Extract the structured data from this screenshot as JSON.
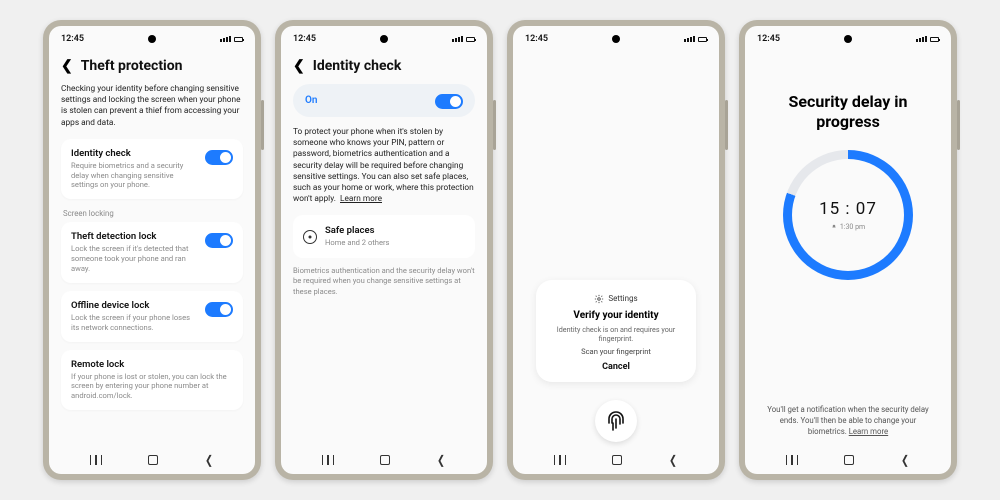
{
  "status": {
    "time": "12:45"
  },
  "screen1": {
    "title": "Theft protection",
    "desc": "Checking your identity before changing sensitive settings and locking the screen when your phone is stolen can prevent a thief from accessing your apps and data.",
    "identity": {
      "title": "Identity check",
      "sub": "Require biometrics and a security delay when changing sensitive settings on your phone."
    },
    "section_label": "Screen locking",
    "theft_lock": {
      "title": "Theft detection lock",
      "sub": "Lock the screen if it's detected that someone took your phone and ran away."
    },
    "offline_lock": {
      "title": "Offline device lock",
      "sub": "Lock the screen if your phone loses its network connections."
    },
    "remote_lock": {
      "title": "Remote lock",
      "sub": "If your phone is lost or stolen, you can lock the screen by entering your phone number at android.com/lock."
    }
  },
  "screen2": {
    "title": "Identity check",
    "on_label": "On",
    "desc": "To protect your phone when it's stolen by someone who knows your PIN, pattern or password, biometrics authentication and a security delay will be required before changing sensitive settings. You can also set safe places, such as your home or work, where this protection won't apply.",
    "learn": "Learn more",
    "safe_title": "Safe places",
    "safe_sub": "Home and 2 others",
    "note": "Biometrics authentication and the security delay won't be required when you change sensitive settings at these places."
  },
  "screen3": {
    "settings_label": "Settings",
    "verify_title": "Verify your identity",
    "verify_desc": "Identity check is on and requires your fingerprint.",
    "scan": "Scan your fingerprint",
    "cancel": "Cancel"
  },
  "screen4": {
    "title": "Security delay in progress",
    "countdown": "15 : 07",
    "endtime": "1:30 pm",
    "note_a": "You'll get a notification when the security delay ends. You'll then be able to change your biometrics. ",
    "learn": "Learn more"
  }
}
